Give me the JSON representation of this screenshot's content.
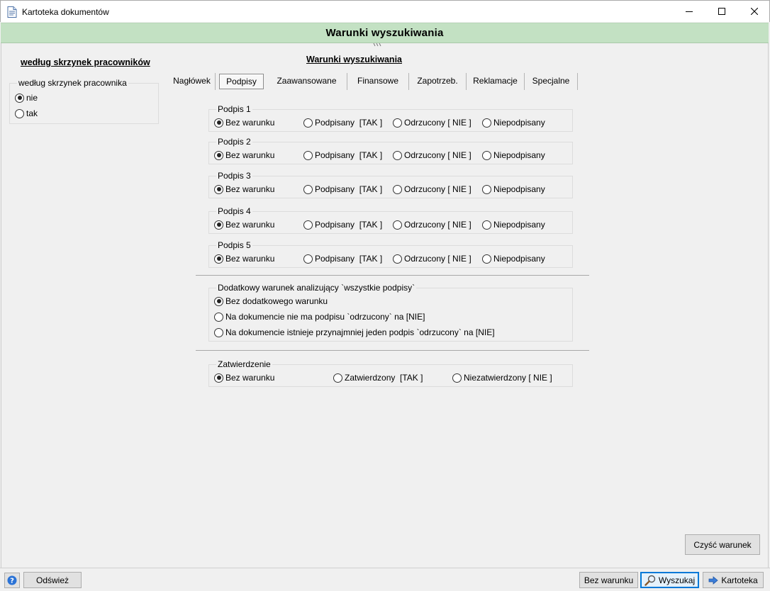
{
  "window": {
    "title": "Kartoteka dokumentów",
    "banner": "Warunki wyszukiwania"
  },
  "left_panel": {
    "heading": "według skrzynek pracowników",
    "group_label": "według skrzynek pracownika",
    "options": [
      {
        "label": "nie",
        "checked": true
      },
      {
        "label": "tak",
        "checked": false
      }
    ]
  },
  "main": {
    "heading": "Warunki wyszukiwania",
    "tabs": [
      {
        "label": "Nagłówek",
        "active": false
      },
      {
        "label": "Podpisy",
        "active": true
      },
      {
        "label": "Zaawansowane",
        "active": false
      },
      {
        "label": "Finansowe",
        "active": false
      },
      {
        "label": "Zapotrzeb.",
        "active": false
      },
      {
        "label": "Reklamacje",
        "active": false
      },
      {
        "label": "Specjalne",
        "active": false
      }
    ],
    "signature_option_labels": [
      "Bez warunku",
      "Podpisany  [TAK ]",
      "Odrzucony [ NIE ]",
      "Niepodpisany"
    ],
    "signatures": [
      {
        "label": "Podpis 1",
        "selected": 0
      },
      {
        "label": "Podpis 2",
        "selected": 0
      },
      {
        "label": "Podpis 3",
        "selected": 0
      },
      {
        "label": "Podpis 4",
        "selected": 0
      },
      {
        "label": "Podpis 5",
        "selected": 0
      }
    ],
    "additional": {
      "label": "Dodatkowy warunek analizujący `wszystkie podpisy`",
      "options": [
        {
          "label": "Bez dodatkowego warunku",
          "checked": true
        },
        {
          "label": "Na dokumencie nie ma podpisu `odrzucony` na [NIE]",
          "checked": false
        },
        {
          "label": "Na dokumencie istnieje przynajmniej jeden podpis `odrzucony` na [NIE]",
          "checked": false
        }
      ]
    },
    "approval": {
      "label": "Zatwierdzenie",
      "options": [
        {
          "label": "Bez warunku",
          "checked": true
        },
        {
          "label": "Zatwierdzony  [TAK ]",
          "checked": false
        },
        {
          "label": "Niezatwierdzony [ NIE ]",
          "checked": false
        }
      ]
    },
    "clear_button": "Czyść warunek"
  },
  "statusbar": {
    "help_icon": "help-icon",
    "refresh": "Odśwież",
    "no_condition": "Bez warunku",
    "search": "Wyszukaj",
    "card": "Kartoteka"
  }
}
